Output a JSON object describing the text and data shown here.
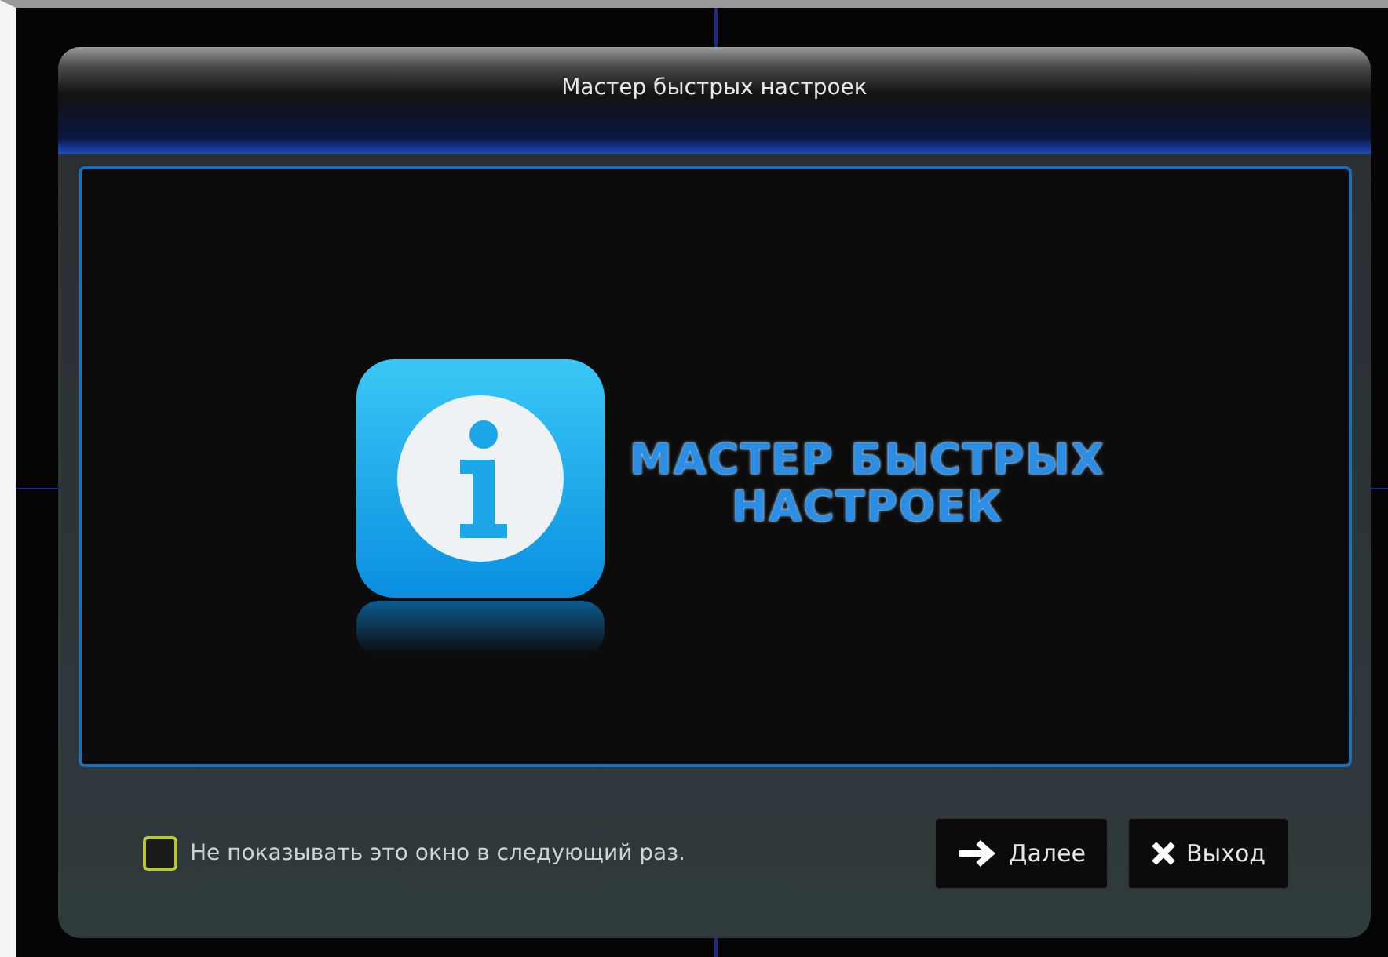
{
  "window": {
    "title": "Мастер быстрых настроек"
  },
  "banner": {
    "title_lines": [
      "МАСТЕР БЫСТРЫХ",
      "НАСТРОЕК"
    ]
  },
  "dont_show": {
    "label": "Не показывать это окно в следующий раз.",
    "checked": false
  },
  "buttons": [
    {
      "label": "Далее",
      "kind": "next"
    },
    {
      "label": "Выход",
      "kind": "exit"
    }
  ]
}
